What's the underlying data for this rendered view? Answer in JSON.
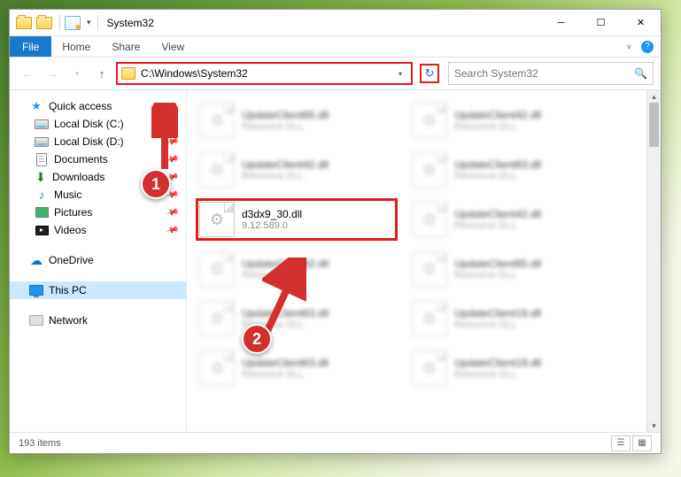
{
  "window": {
    "title": "System32"
  },
  "ribbon": {
    "file": "File",
    "tabs": [
      "Home",
      "Share",
      "View"
    ]
  },
  "nav": {
    "address": "C:\\Windows\\System32",
    "search_placeholder": "Search System32"
  },
  "sidebar": {
    "quick_access": "Quick access",
    "items": [
      {
        "label": "Local Disk (C:)",
        "pinned": true,
        "icon": "disk"
      },
      {
        "label": "Local Disk (D:)",
        "pinned": true,
        "icon": "disk"
      },
      {
        "label": "Documents",
        "pinned": true,
        "icon": "doc"
      },
      {
        "label": "Downloads",
        "pinned": true,
        "icon": "download"
      },
      {
        "label": "Music",
        "pinned": true,
        "icon": "music"
      },
      {
        "label": "Pictures",
        "pinned": true,
        "icon": "picture"
      },
      {
        "label": "Videos",
        "pinned": true,
        "icon": "video"
      }
    ],
    "onedrive": "OneDrive",
    "this_pc": "This PC",
    "network": "Network"
  },
  "files": [
    {
      "name": "UpdateClient65.dll",
      "sub": "Resource DLL",
      "blurred": true
    },
    {
      "name": "UpdateClient42.dll",
      "sub": "Resource DLL",
      "blurred": true
    },
    {
      "name": "UpdateClient42.dll",
      "sub": "Resource DLL",
      "blurred": true
    },
    {
      "name": "UpdateClient63.dll",
      "sub": "Resource DLL",
      "blurred": true
    },
    {
      "name": "d3dx9_30.dll",
      "sub": "9.12.589.0",
      "blurred": false,
      "highlighted": true
    },
    {
      "name": "UpdateClient42.dll",
      "sub": "Resource DLL",
      "blurred": true
    },
    {
      "name": "UpdateClient42.dll",
      "sub": "Resource DLL",
      "blurred": true
    },
    {
      "name": "UpdateClient65.dll",
      "sub": "Resource DLL",
      "blurred": true
    },
    {
      "name": "UpdateClient63.dll",
      "sub": "Resource DLL",
      "blurred": true
    },
    {
      "name": "UpdateClient19.dll",
      "sub": "Resource DLL",
      "blurred": true
    },
    {
      "name": "UpdateClient63.dll",
      "sub": "Resource DLL",
      "blurred": true
    },
    {
      "name": "UpdateClient19.dll",
      "sub": "Resource DLL",
      "blurred": true
    }
  ],
  "status": {
    "count": "193 items"
  },
  "callouts": {
    "one": "1",
    "two": "2"
  }
}
